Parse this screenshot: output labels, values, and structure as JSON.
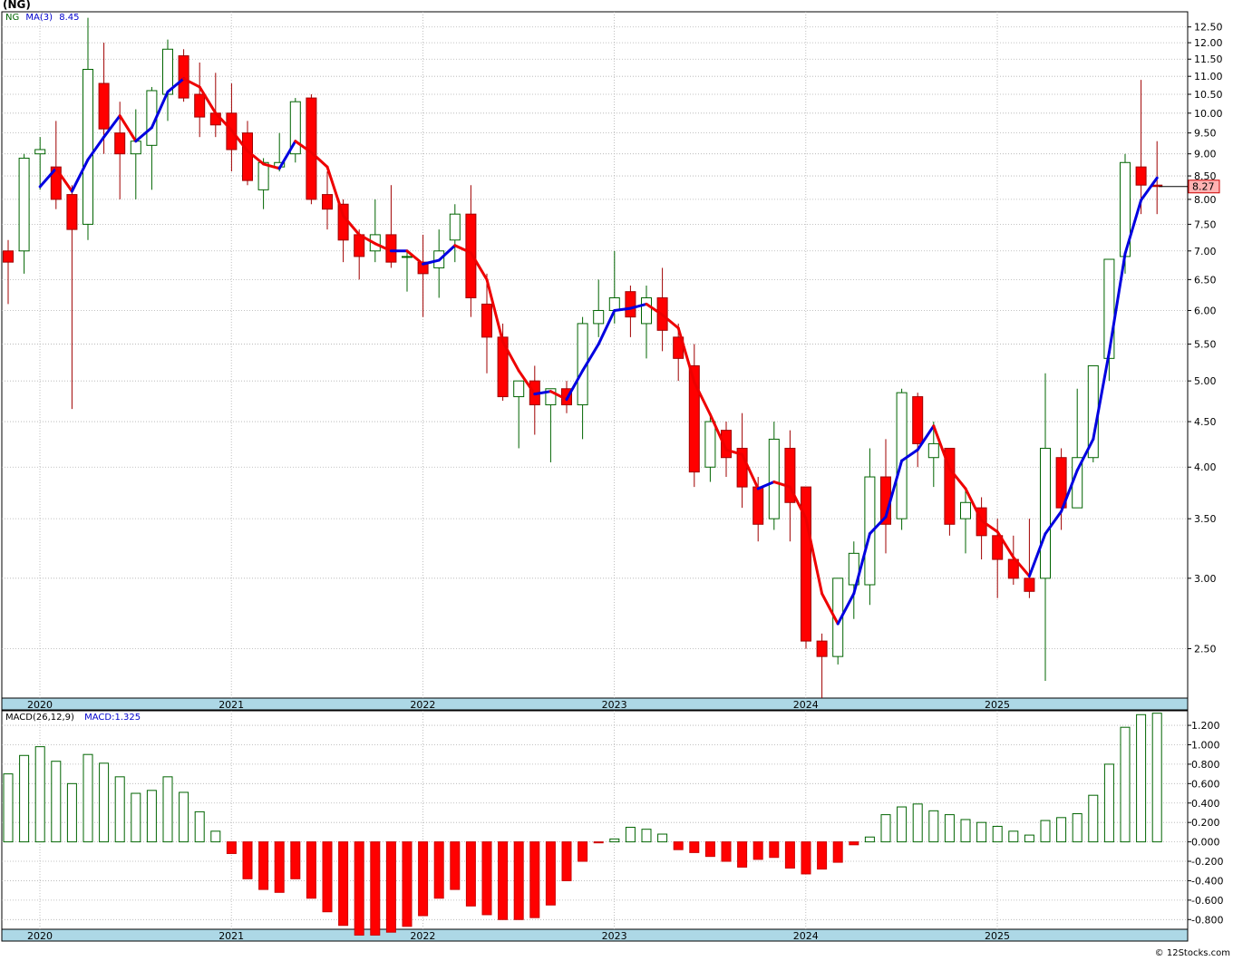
{
  "ticker_title": "(NG)",
  "price_legend": {
    "symbol": "NG",
    "ma_label": "MA(3)",
    "ma_value": "8.45"
  },
  "macd_legend": {
    "label": "MACD(26,12,9)",
    "value_label": "MACD:1.325"
  },
  "last_price_label": "8.27",
  "credit": "© 12Stocks.com",
  "colors": {
    "up_body": "#ffffff",
    "up_edge": "#006400",
    "down_body": "#ff0000",
    "down_edge": "#a00000",
    "ma_up": "#0000e0",
    "ma_down": "#ee0000",
    "axis_band": "#add8e6",
    "grid": "#b0b0b0"
  },
  "chart_data": [
    {
      "type": "candlestick",
      "scale": "log",
      "interval": "monthly",
      "start": "2020-01",
      "ylim": [
        2.2,
        13.0
      ],
      "y_ticks": [
        "2.50",
        "3.00",
        "3.50",
        "4.00",
        "4.50",
        "5.00",
        "5.50",
        "6.00",
        "6.50",
        "7.00",
        "7.50",
        "8.00",
        "8.50",
        "9.00",
        "9.50",
        "10.00",
        "10.50",
        "11.00",
        "11.50",
        "12.00",
        "12.50"
      ],
      "x_tick_labels": [
        "2020",
        "2021",
        "2022",
        "2023",
        "2024",
        "2025"
      ],
      "last_value": 8.27,
      "candles": [
        [
          7.0,
          7.2,
          6.1,
          6.8
        ],
        [
          7.0,
          9.0,
          6.6,
          8.9
        ],
        [
          9.0,
          9.4,
          8.2,
          9.1
        ],
        [
          8.7,
          9.8,
          7.8,
          8.0
        ],
        [
          8.1,
          8.3,
          4.65,
          7.4
        ],
        [
          7.5,
          12.8,
          7.2,
          11.2
        ],
        [
          10.8,
          12.0,
          9.0,
          9.6
        ],
        [
          9.5,
          10.3,
          8.0,
          9.0
        ],
        [
          9.0,
          10.1,
          8.0,
          9.3
        ],
        [
          9.2,
          10.7,
          8.2,
          10.6
        ],
        [
          10.5,
          12.1,
          9.8,
          11.8
        ],
        [
          11.6,
          11.8,
          10.3,
          10.4
        ],
        [
          10.5,
          11.4,
          9.4,
          9.9
        ],
        [
          10.0,
          11.1,
          9.4,
          9.7
        ],
        [
          10.0,
          10.8,
          8.6,
          9.1
        ],
        [
          9.5,
          9.8,
          8.3,
          8.4
        ],
        [
          8.2,
          8.9,
          7.8,
          8.8
        ],
        [
          8.7,
          9.5,
          8.6,
          8.8
        ],
        [
          9.0,
          10.4,
          8.8,
          10.3
        ],
        [
          10.4,
          10.5,
          7.9,
          8.0
        ],
        [
          8.1,
          8.6,
          7.4,
          7.8
        ],
        [
          7.9,
          8.0,
          6.8,
          7.2
        ],
        [
          7.3,
          7.4,
          6.5,
          6.9
        ],
        [
          7.0,
          8.0,
          6.8,
          7.3
        ],
        [
          7.3,
          8.3,
          6.7,
          6.8
        ],
        [
          6.9,
          7.0,
          6.3,
          6.9
        ],
        [
          6.8,
          7.3,
          5.9,
          6.6
        ],
        [
          6.7,
          7.4,
          6.2,
          7.0
        ],
        [
          7.2,
          7.9,
          6.8,
          7.7
        ],
        [
          7.7,
          8.3,
          5.9,
          6.2
        ],
        [
          6.1,
          6.6,
          5.1,
          5.6
        ],
        [
          5.6,
          5.8,
          4.75,
          4.8
        ],
        [
          4.8,
          5.0,
          4.2,
          5.0
        ],
        [
          5.0,
          5.2,
          4.35,
          4.7
        ],
        [
          4.7,
          4.9,
          4.05,
          4.9
        ],
        [
          4.9,
          5.0,
          4.6,
          4.7
        ],
        [
          4.7,
          5.9,
          4.3,
          5.8
        ],
        [
          5.8,
          6.5,
          5.6,
          6.0
        ],
        [
          6.0,
          7.0,
          5.8,
          6.2
        ],
        [
          6.3,
          6.4,
          5.6,
          5.9
        ],
        [
          5.8,
          6.4,
          5.3,
          6.2
        ],
        [
          6.2,
          6.7,
          5.4,
          5.7
        ],
        [
          5.6,
          5.8,
          5.0,
          5.3
        ],
        [
          5.2,
          5.5,
          3.8,
          3.95
        ],
        [
          4.0,
          4.6,
          3.85,
          4.5
        ],
        [
          4.4,
          4.5,
          3.9,
          4.1
        ],
        [
          4.2,
          4.6,
          3.6,
          3.8
        ],
        [
          3.8,
          3.9,
          3.3,
          3.45
        ],
        [
          3.5,
          4.5,
          3.4,
          4.3
        ],
        [
          4.2,
          4.4,
          3.3,
          3.65
        ],
        [
          3.8,
          3.8,
          2.5,
          2.55
        ],
        [
          2.55,
          2.6,
          2.2,
          2.45
        ],
        [
          2.45,
          3.0,
          2.4,
          3.0
        ],
        [
          2.95,
          3.3,
          2.7,
          3.2
        ],
        [
          2.95,
          4.2,
          2.8,
          3.9
        ],
        [
          3.9,
          4.3,
          3.2,
          3.45
        ],
        [
          3.5,
          4.9,
          3.4,
          4.85
        ],
        [
          4.8,
          4.85,
          4.0,
          4.25
        ],
        [
          4.1,
          4.5,
          3.8,
          4.25
        ],
        [
          4.2,
          4.2,
          3.35,
          3.45
        ],
        [
          3.5,
          3.8,
          3.2,
          3.65
        ],
        [
          3.6,
          3.7,
          3.15,
          3.35
        ],
        [
          3.35,
          3.5,
          2.85,
          3.15
        ],
        [
          3.15,
          3.35,
          2.95,
          3.0
        ],
        [
          3.0,
          3.5,
          2.85,
          2.9
        ],
        [
          3.0,
          5.1,
          2.3,
          4.2
        ],
        [
          4.1,
          4.2,
          3.4,
          3.6
        ],
        [
          3.6,
          4.9,
          3.6,
          4.1
        ],
        [
          4.1,
          4.9,
          4.05,
          5.2
        ],
        [
          5.3,
          6.2,
          5.0,
          6.85
        ],
        [
          6.9,
          9.0,
          6.6,
          8.8
        ],
        [
          8.7,
          10.9,
          7.7,
          8.3
        ],
        [
          8.3,
          9.3,
          7.7,
          8.27
        ]
      ],
      "ma_period": 3
    },
    {
      "type": "bar",
      "name": "MACD(26,12,9)",
      "ylim": [
        -0.9,
        1.35
      ],
      "y_ticks": [
        "1.200",
        "1.000",
        "0.800",
        "0.600",
        "0.400",
        "0.200",
        "0.000",
        "-0.200",
        "-0.400",
        "-0.600",
        "-0.800"
      ],
      "x_tick_labels": [
        "2020",
        "2021",
        "2022",
        "2023",
        "2024",
        "2025"
      ],
      "values": [
        0.7,
        0.89,
        0.98,
        0.83,
        0.6,
        0.9,
        0.81,
        0.67,
        0.5,
        0.53,
        0.67,
        0.51,
        0.31,
        0.11,
        -0.12,
        -0.38,
        -0.49,
        -0.52,
        -0.38,
        -0.58,
        -0.72,
        -0.86,
        -0.96,
        -0.96,
        -0.93,
        -0.87,
        -0.76,
        -0.58,
        -0.49,
        -0.66,
        -0.75,
        -0.8,
        -0.8,
        -0.78,
        -0.65,
        -0.4,
        -0.2,
        -0.01,
        0.03,
        0.15,
        0.13,
        0.08,
        -0.08,
        -0.11,
        -0.15,
        -0.2,
        -0.26,
        -0.18,
        -0.16,
        -0.27,
        -0.33,
        -0.28,
        -0.21,
        -0.03,
        0.05,
        0.28,
        0.36,
        0.39,
        0.32,
        0.28,
        0.23,
        0.2,
        0.16,
        0.11,
        0.07,
        0.22,
        0.25,
        0.29,
        0.48,
        0.8,
        1.18,
        1.31,
        1.325
      ]
    }
  ]
}
